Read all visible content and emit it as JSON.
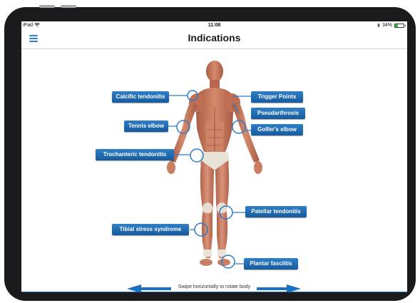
{
  "status_bar": {
    "device": "iPad",
    "time": "11:08",
    "battery": "34%",
    "battery_level": 0.34
  },
  "header": {
    "title": "Indications"
  },
  "labels": {
    "calcific_tendonitis": "Calcific tendonitis",
    "trigger_points": "Trigger Points",
    "pseudarthrosis": "Pseudarthrosis",
    "tennis_elbow": "Tennis elbow",
    "golfers_elbow": "Golfer's elbow",
    "trochanteric_tendonitis": "Trochanteric tendonitis",
    "patellar_tendonitis": "Patellar tendonitis",
    "tibial_stress_syndrome": "Tibial stress syndrome",
    "plantar_fasciitis": "Plantar fasciitis"
  },
  "footer": {
    "hint": "Swipe horizontally to rotate body"
  },
  "colors": {
    "accent": "#1d6fc0",
    "label_bg": "#1f6cb4",
    "muscle": "#c8735a",
    "tendon": "#e8e2d8"
  },
  "icons": [
    "menu-icon",
    "wifi-icon",
    "bluetooth-icon",
    "battery-icon",
    "arrow-left-icon",
    "arrow-right-icon"
  ]
}
